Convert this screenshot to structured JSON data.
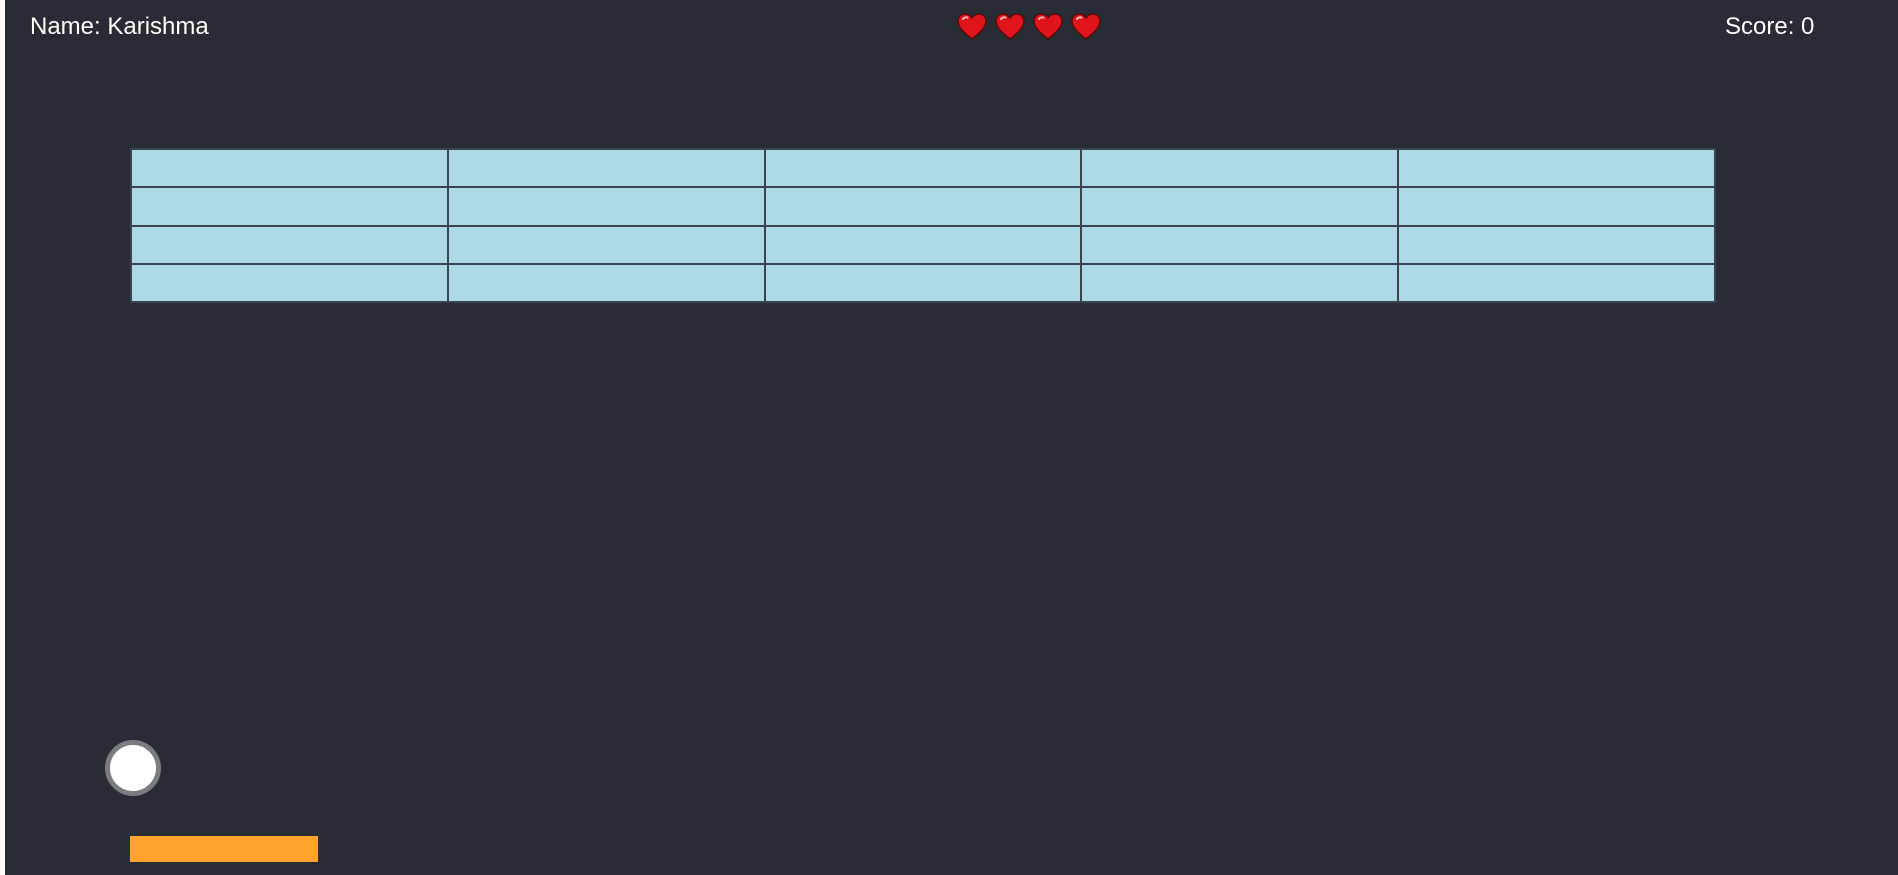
{
  "hud": {
    "name_text": "Name: Karishma",
    "score_text": "Score: 0",
    "lives": 4,
    "heart_icon": "heart-icon",
    "heart_color": "#e0141c"
  },
  "board": {
    "background": "#282c35",
    "brick_rows": 4,
    "brick_cols": 5,
    "brick_color": "#add8e6",
    "brick_border": "#3b4250"
  },
  "ball": {
    "fill": "#ffffff",
    "outline": "#7a7c80"
  },
  "paddle": {
    "color": "#ffa22e"
  }
}
